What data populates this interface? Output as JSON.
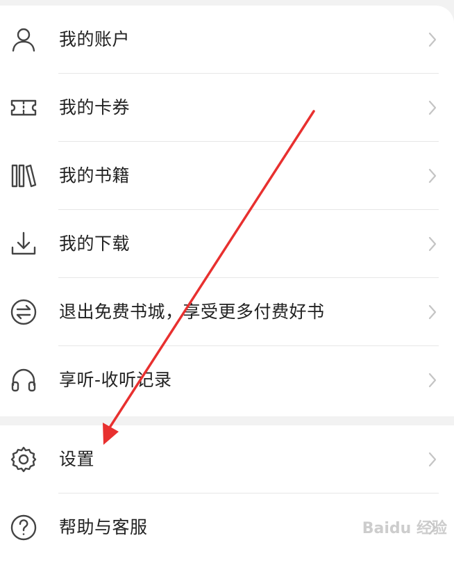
{
  "menu_group_1": [
    {
      "label": "我的账户",
      "icon": "user-icon"
    },
    {
      "label": "我的卡券",
      "icon": "ticket-icon"
    },
    {
      "label": "我的书籍",
      "icon": "books-icon"
    },
    {
      "label": "我的下载",
      "icon": "download-icon"
    },
    {
      "label": "退出免费书城，享受更多付费好书",
      "icon": "exchange-icon"
    },
    {
      "label": "享听-收听记录",
      "icon": "headphones-icon"
    }
  ],
  "menu_group_2": [
    {
      "label": "设置",
      "icon": "gear-icon"
    },
    {
      "label": "帮助与客服",
      "icon": "help-icon"
    }
  ],
  "annotation": {
    "type": "red-arrow",
    "color": "#e8302f",
    "points_to": "设置"
  },
  "watermark": {
    "text": "Baidu 经验"
  },
  "colors": {
    "background": "#f2f2f2",
    "card": "#ffffff",
    "text": "#222222",
    "icon": "#444444",
    "chevron": "#c4c4c4",
    "divider": "#e6e6e6",
    "arrow": "#e8302f"
  }
}
